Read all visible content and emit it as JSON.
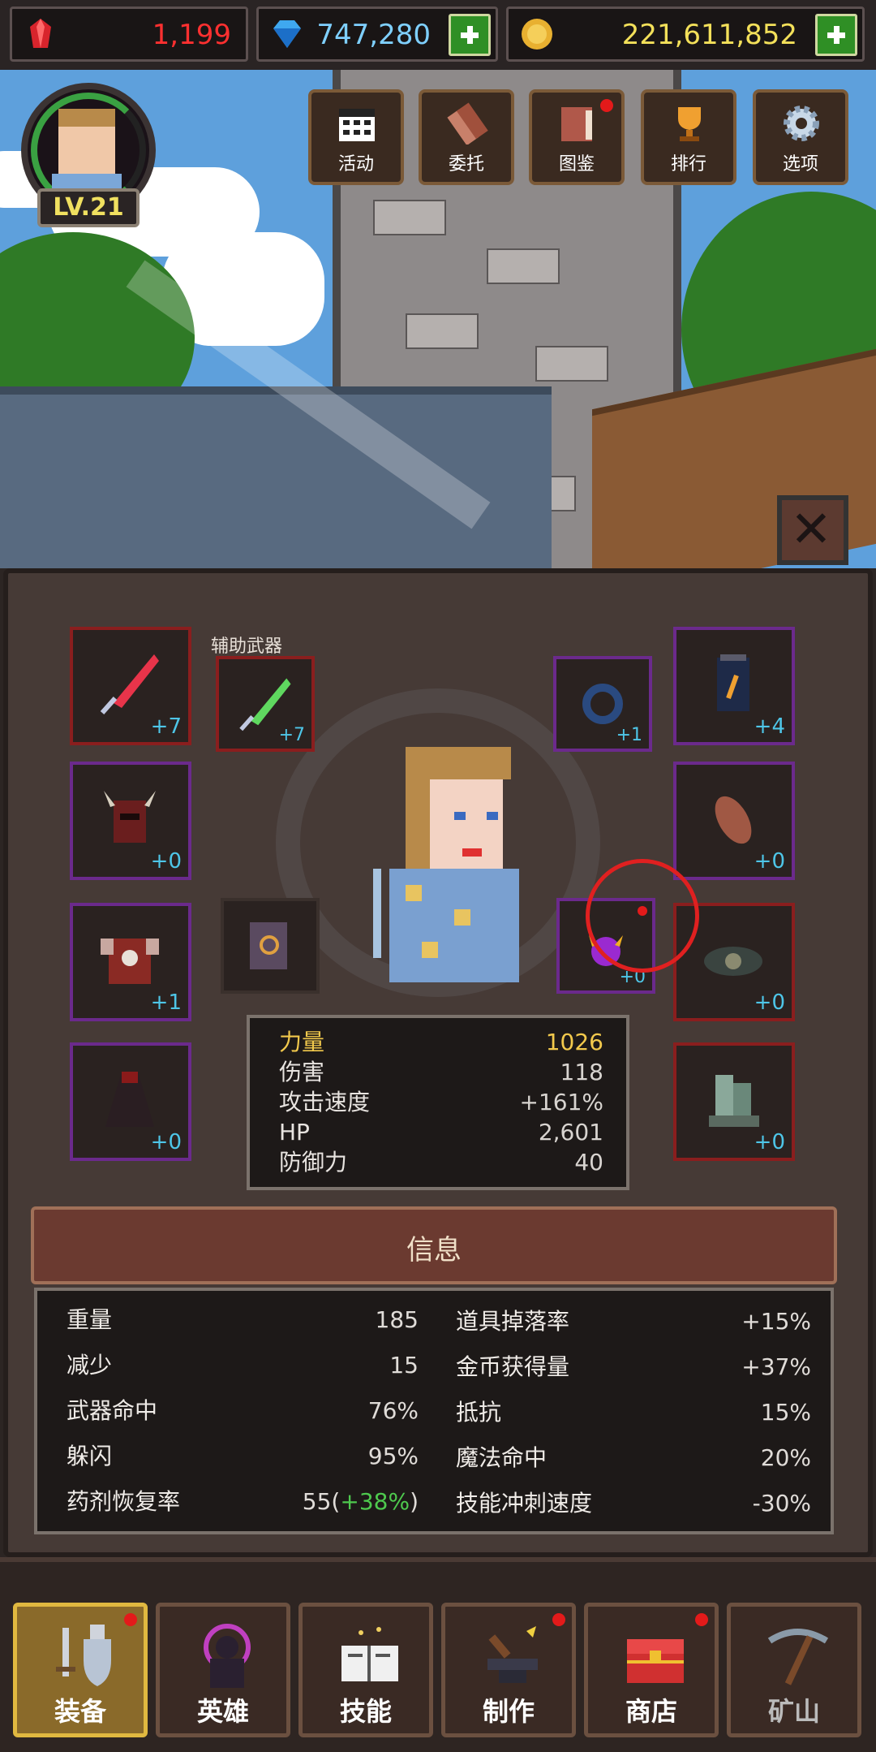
{
  "resources": {
    "rubies": "1,199",
    "gems": "747,280",
    "gold": "221,611,852"
  },
  "player": {
    "level": "LV.21"
  },
  "top_menu": [
    {
      "label": "活动",
      "icon": "calendar-icon"
    },
    {
      "label": "委托",
      "icon": "scroll-icon"
    },
    {
      "label": "图鉴",
      "icon": "book-icon",
      "notification": true
    },
    {
      "label": "排行",
      "icon": "trophy-icon"
    },
    {
      "label": "选项",
      "icon": "gear-icon"
    }
  ],
  "equipment": {
    "aux_weapon_label": "辅助武器",
    "slots": {
      "main_weapon": "+7",
      "aux_weapon": "+7",
      "ring": "+1",
      "potion": "+4",
      "helmet": "+0",
      "gloves": "+0",
      "armor": "+1",
      "pet": "+0",
      "eye": "+0",
      "cloak": "+0",
      "boots": "+0"
    }
  },
  "hero_stats": [
    {
      "label": "力量",
      "value": "1026"
    },
    {
      "label": "伤害",
      "value": "118"
    },
    {
      "label": "攻击速度",
      "value": "+161%"
    },
    {
      "label": "HP",
      "value": "2,601"
    },
    {
      "label": "防御力",
      "value": "40"
    }
  ],
  "info": {
    "title": "信息",
    "left": [
      {
        "label": "重量",
        "value": "185"
      },
      {
        "label": "减少",
        "value": "15"
      },
      {
        "label": "武器命中",
        "value": "76%"
      },
      {
        "label": "躲闪",
        "value": "95%"
      },
      {
        "label": "药剂恢复率",
        "value": "55",
        "bonus": "+38%"
      }
    ],
    "right": [
      {
        "label": "道具掉落率",
        "value": "+15%"
      },
      {
        "label": "金币获得量",
        "value": "+37%"
      },
      {
        "label": "抵抗",
        "value": "15%"
      },
      {
        "label": "魔法命中",
        "value": "20%"
      },
      {
        "label": "技能冲刺速度",
        "value": "-30%"
      }
    ]
  },
  "bottom_nav": [
    {
      "label": "装备",
      "icon": "equipment-icon",
      "active": true,
      "notification": true
    },
    {
      "label": "英雄",
      "icon": "hero-icon"
    },
    {
      "label": "技能",
      "icon": "skill-book-icon"
    },
    {
      "label": "制作",
      "icon": "anvil-icon",
      "notification": true
    },
    {
      "label": "商店",
      "icon": "treasure-chest-icon",
      "notification": true
    },
    {
      "label": "矿山",
      "icon": "pickaxe-icon"
    }
  ]
}
